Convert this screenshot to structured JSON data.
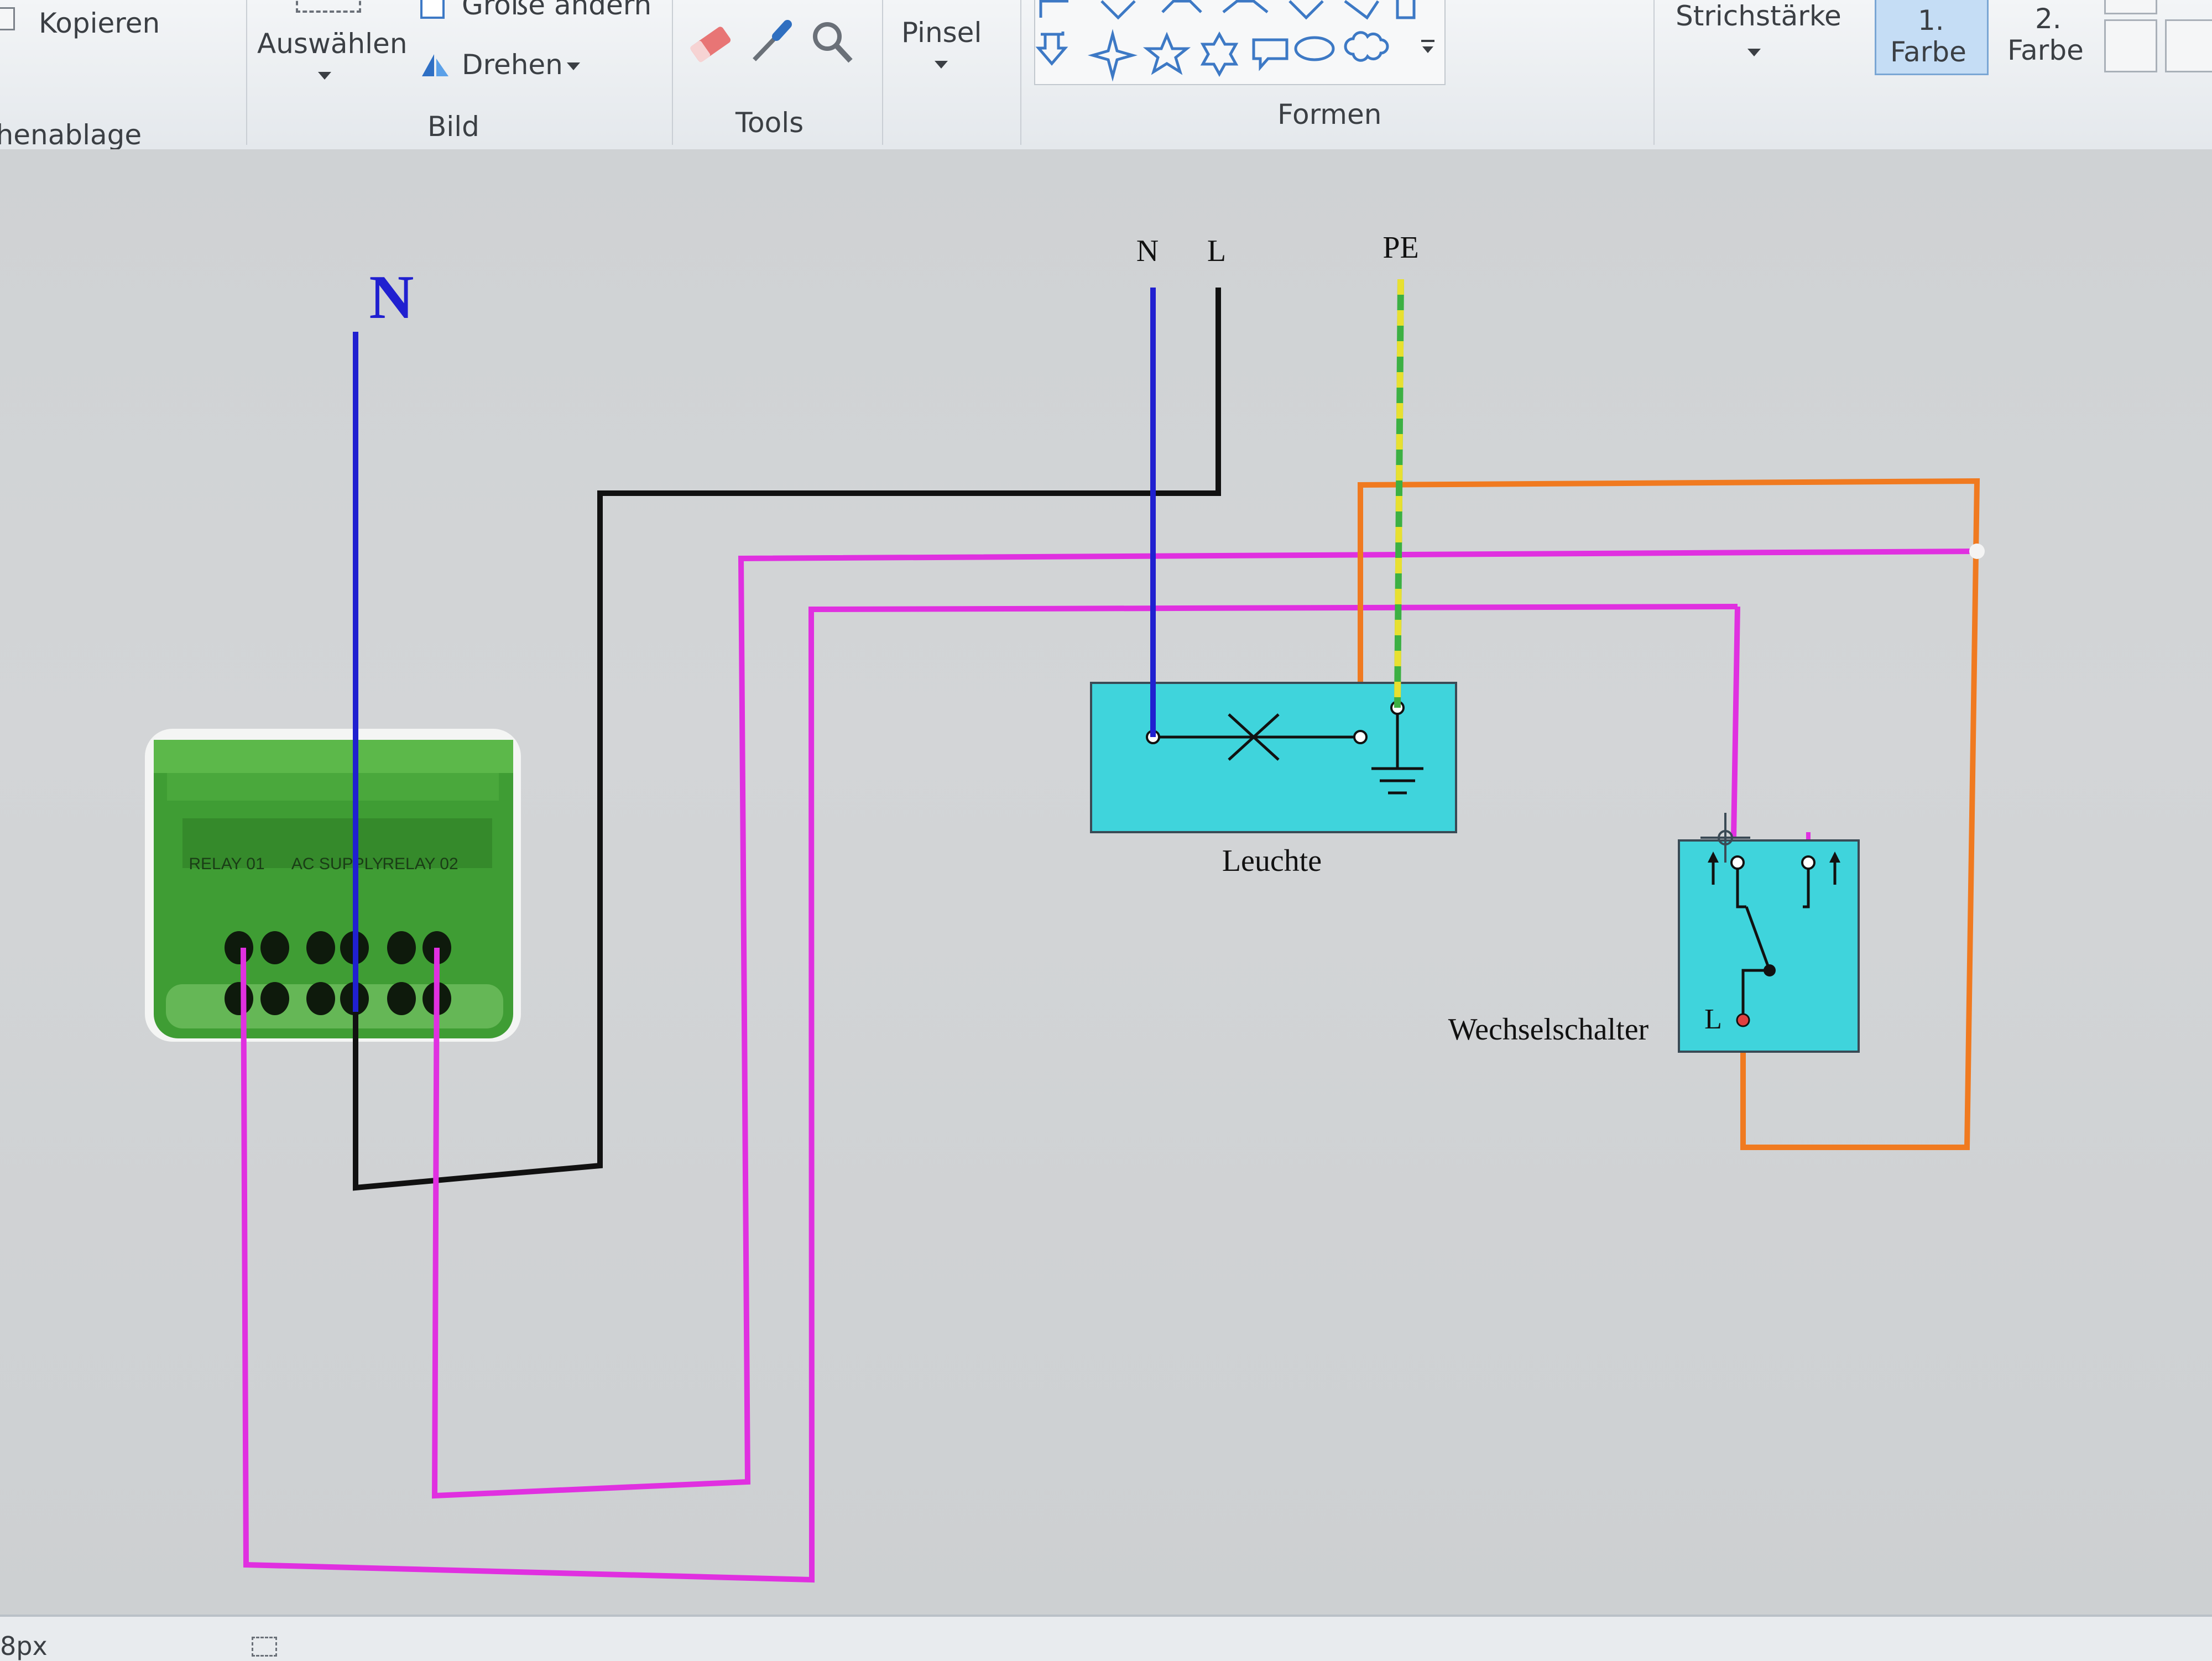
{
  "ribbon": {
    "clipboard": {
      "copy_label": "Kopieren",
      "group_label": "Zwischenablage"
    },
    "image": {
      "select_label": "Auswählen",
      "resize_label": "Größe ändern",
      "rotate_label": "Drehen",
      "group_label": "Bild"
    },
    "tools": {
      "group_label": "Tools",
      "icons": [
        "eraser-icon",
        "color-picker-icon",
        "magnifier-icon"
      ]
    },
    "brush": {
      "label": "Pinsel"
    },
    "shapes": {
      "group_label": "Formen",
      "icons": [
        "arrow-down-shape",
        "four-point-star-shape",
        "five-point-star-shape",
        "six-point-star-shape",
        "rect-callout-shape",
        "oval-callout-shape",
        "cloud-callout-shape"
      ]
    },
    "stroke": {
      "label": "Strichstärke"
    },
    "colors": {
      "color1_number": "1.",
      "color1_label": "Farbe",
      "color2_number": "2.",
      "color2_label": "Farbe"
    }
  },
  "diagram": {
    "labels": {
      "neutral_left": "N",
      "neutral_top": "N",
      "line_top": "L",
      "earth_top": "PE",
      "lamp": "Leuchte",
      "switch": "Wechselschalter",
      "switch_terminal": "L"
    },
    "relay_module": {
      "text_blocks": [
        "RELAY 01",
        "AC SUPPLY",
        "RELAY 02"
      ]
    },
    "wire_colors": {
      "neutral": "#2020d0",
      "line": "#111111",
      "switched": "#e030e0",
      "traveler": "#f07a20",
      "earth_green": "#3cb043",
      "earth_yellow": "#e8e030",
      "box_fill": "#3fd4dc"
    }
  },
  "statusbar": {
    "size_text": "8px"
  }
}
